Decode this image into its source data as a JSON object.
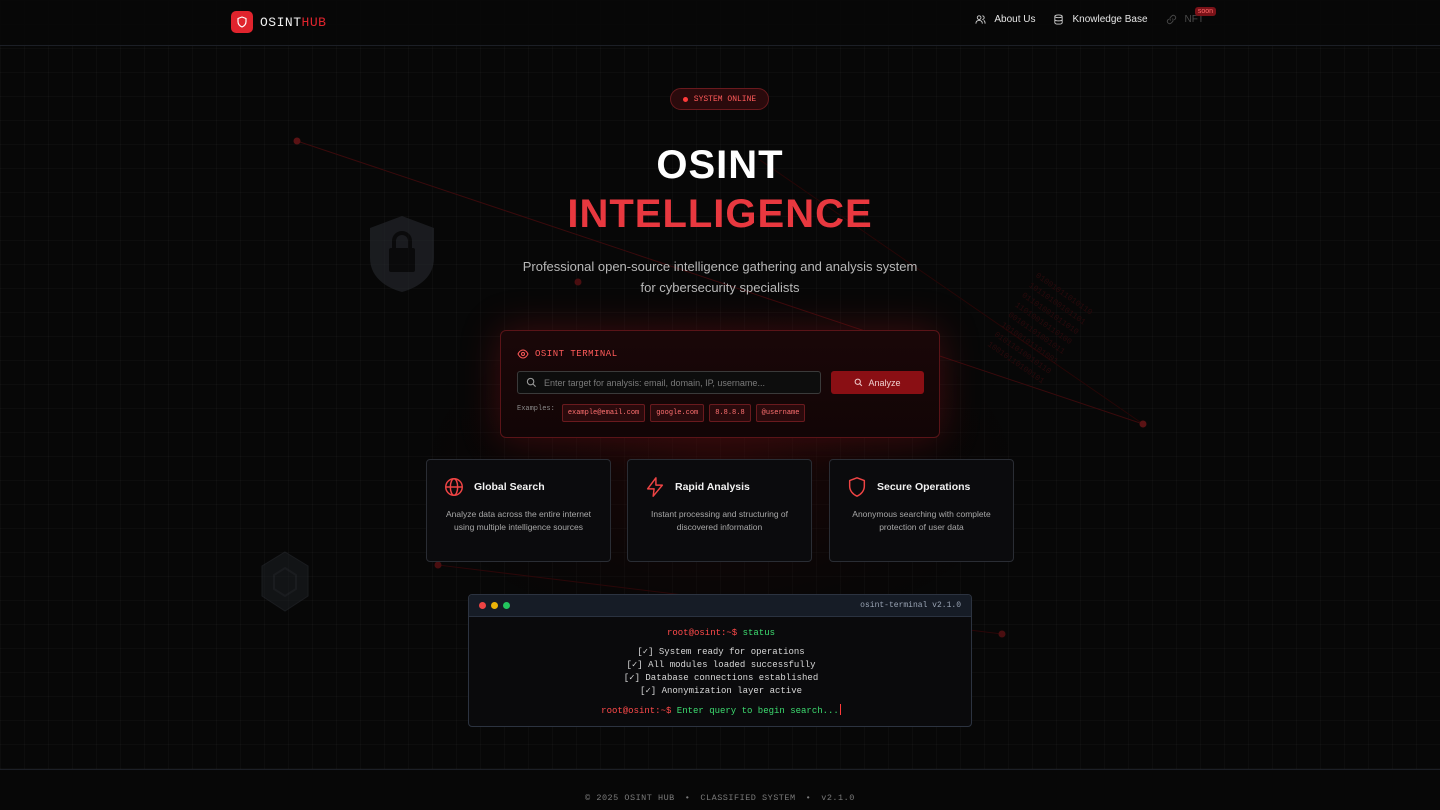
{
  "brand": {
    "name_white": "OSINT",
    "name_red": "HUB"
  },
  "nav": {
    "about": "About Us",
    "knowledge": "Knowledge Base",
    "nft": "NFT",
    "nft_badge": "soon"
  },
  "hero": {
    "status": "SYSTEM ONLINE",
    "title_line1": "OSINT",
    "title_line2": "INTELLIGENCE",
    "subtitle_line1": "Professional open-source intelligence gathering and analysis system",
    "subtitle_line2": "for cybersecurity specialists"
  },
  "search": {
    "label": "OSINT TERMINAL",
    "placeholder": "Enter target for analysis: email, domain, IP, username...",
    "button": "Analyze",
    "examples_label": "Examples:",
    "examples": [
      "example@email.com",
      "google.com",
      "8.8.8.8",
      "@username"
    ]
  },
  "features": [
    {
      "title": "Global Search",
      "desc": "Analyze data across the entire internet using multiple intelligence sources",
      "icon": "globe-icon"
    },
    {
      "title": "Rapid Analysis",
      "desc": "Instant processing and structuring of discovered information",
      "icon": "lightning-icon"
    },
    {
      "title": "Secure Operations",
      "desc": "Anonymous searching with complete protection of user data",
      "icon": "shield-icon"
    }
  ],
  "console": {
    "title": "osint-terminal v2.1.0",
    "prompt": "root@osint:~$",
    "command": "status",
    "lines": [
      "[✓] System ready for operations",
      "[✓] All modules loaded successfully",
      "[✓] Database connections established",
      "[✓] Anonymization layer active"
    ],
    "final_prompt": "root@osint:~$",
    "final_text": "Enter query to begin search..."
  },
  "footer": {
    "copyright": "© 2025 OSINT HUB",
    "classified": "CLASSIFIED SYSTEM",
    "version": "v2.1.0"
  },
  "colors": {
    "accent": "#e0242d",
    "green": "#3ddc70",
    "bg": "#070707"
  }
}
